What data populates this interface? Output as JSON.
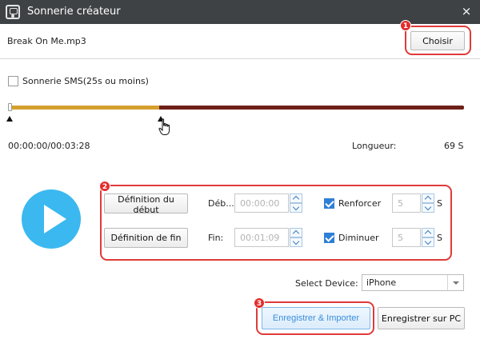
{
  "window": {
    "title": "Sonnerie créateur",
    "close_glyph": "×"
  },
  "file": {
    "name": "Break On Me.mp3",
    "choose_label": "Choisir"
  },
  "sms": {
    "label": "Sonnerie SMS(25s ou moins)",
    "checked": false
  },
  "timeline": {
    "selection_fraction": 0.33,
    "time_display": "00:00:00/00:03:28",
    "length_label": "Longueur:",
    "length_value": "69 S"
  },
  "controls": {
    "set_start_label": "Définition du début",
    "start_label": "Déb...",
    "start_value": "00:00:00",
    "set_end_label": "Définition de fin",
    "end_label": "Fin:",
    "end_value": "00:01:09",
    "fade_in_label": "Renforcer",
    "fade_in_checked": true,
    "fade_in_value": "5",
    "fade_out_label": "Diminuer",
    "fade_out_checked": true,
    "fade_out_value": "5",
    "seconds_unit": "S"
  },
  "device": {
    "label": "Select Device:",
    "selected": "iPhone"
  },
  "actions": {
    "save_import_label": "Enregistrer & Importer",
    "save_pc_label": "Enregistrer sur PC"
  },
  "badges": {
    "one": "1",
    "two": "2",
    "three": "3"
  },
  "colors": {
    "titlebar": "#3f4245",
    "accent_blue": "#3bb8ef",
    "track_played": "#d5a02e",
    "track_remaining": "#6d1f18",
    "highlight_red": "#e03a3a"
  },
  "icons": {
    "app": "music-player-icon",
    "close": "close-icon",
    "play": "play-icon",
    "cursor": "hand-cursor-icon",
    "dropdown": "chevron-down-icon"
  }
}
